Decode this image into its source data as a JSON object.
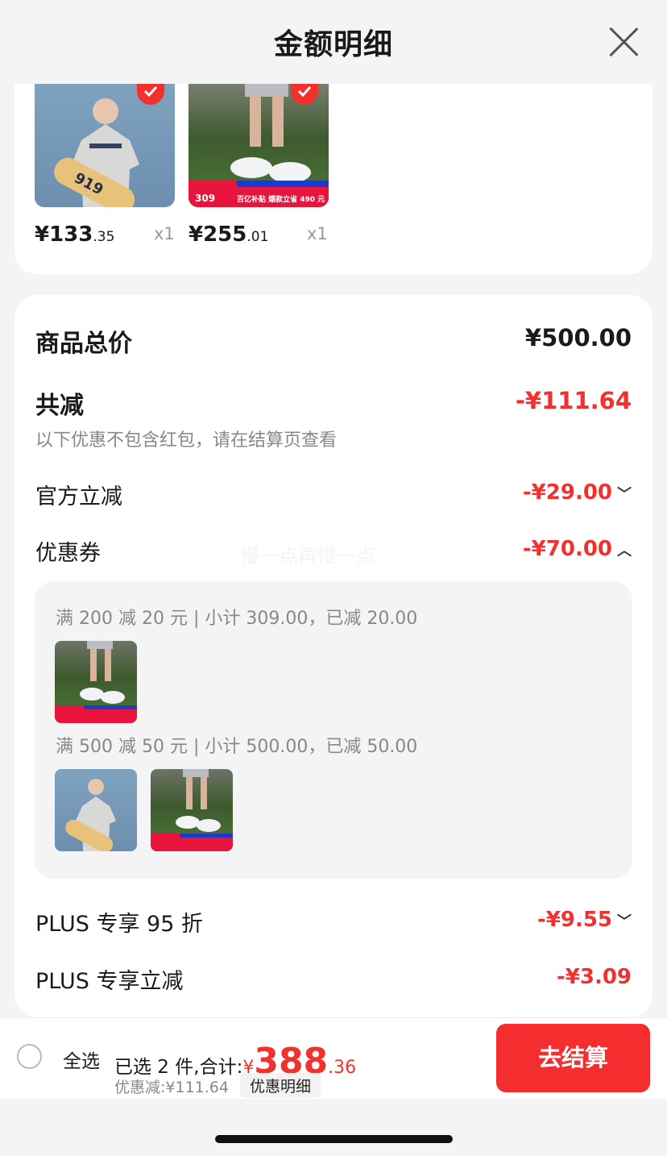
{
  "header": {
    "title": "金额明细"
  },
  "items": [
    {
      "price_main": "¥133",
      "price_dec": ".35",
      "qty": "x1",
      "photo_text": "919"
    },
    {
      "price_main": "¥255",
      "price_dec": ".01",
      "qty": "x1",
      "badge_price": "309",
      "banner": "百亿补贴 爆款立省 490 元"
    }
  ],
  "summary": {
    "goods_total_label": "商品总价",
    "goods_total": "¥500.00",
    "total_reduce_label": "共减",
    "total_reduce": "-¥111.64",
    "note": "以下优惠不包含红包，请在结算页查看",
    "official_label": "官方立减",
    "official": "-¥29.00",
    "coupon_label": "优惠券",
    "coupon": "-¥70.00",
    "watermark": "慢一点再慢一点",
    "coupon_rules": [
      "满 200 减 20 元 | 小计 309.00，已减 20.00",
      "满 500 减 50 元 | 小计 500.00，已减 50.00"
    ],
    "plus95_label": "PLUS 专享 95 折",
    "plus95": "-¥9.55",
    "plusreduce_label": "PLUS 专享立减",
    "plusreduce": "-¥3.09"
  },
  "bottom": {
    "select_all": "全选",
    "selected_text": "已选 2 件,合计:",
    "currency": "¥",
    "total_int": "388",
    "total_dec": ".36",
    "saved": "优惠减:¥111.64",
    "detail": "优惠明细",
    "checkout": "去结算"
  },
  "colors": {
    "accent": "#f2302e",
    "background": "#f4f4f4"
  },
  "icons": {
    "close": "close-icon",
    "check": "check-icon",
    "chevron_down": "chevron-down-icon",
    "chevron_up": "chevron-up-icon"
  }
}
